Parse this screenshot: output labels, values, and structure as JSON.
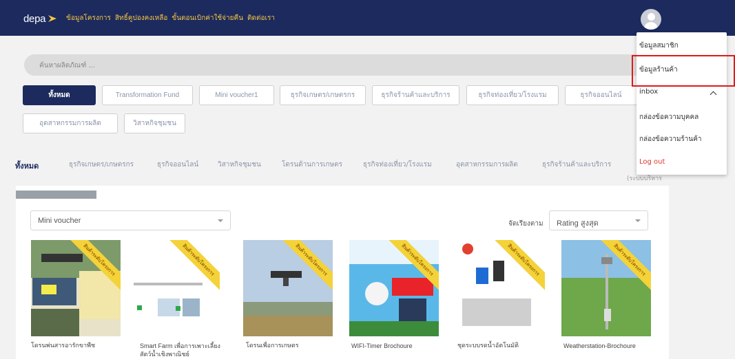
{
  "brand": {
    "logo_text": "depa"
  },
  "nav": {
    "links": [
      "ข้อมูลโครงการ",
      "สิทธิ์คูปองคงเหลือ",
      "ขั้นตอนเบิกค่าใช้จ่ายคืน",
      "ติดต่อเรา"
    ]
  },
  "search": {
    "placeholder": "ค้นหาผลิตภัณฑ์ ..."
  },
  "filter_chips": [
    {
      "label": "ทั้งหมด",
      "active": true
    },
    {
      "label": "Transformation Fund"
    },
    {
      "label": "Mini voucher1"
    },
    {
      "label": "ธุรกิจเกษตร/เกษตรกร"
    },
    {
      "label": "ธุรกิจร้านค้าและบริการ"
    },
    {
      "label": "ธุรกิจท่องเที่ยว/โรงแรม"
    },
    {
      "label": "ธุรกิจออนไลน์"
    },
    {
      "label": "อุตสาหกรรมการผลิต"
    },
    {
      "label": "วิสาหกิจชุมชน"
    }
  ],
  "category_tabs": [
    {
      "label": "ทั้งหมด",
      "active": true
    },
    {
      "label": "ธุรกิจเกษตร/เกษตรกร"
    },
    {
      "label": "ธุรกิจออนไลน์"
    },
    {
      "label": "วิสาหกิจชุมชน"
    },
    {
      "label": "โดรนด้านการเกษตร"
    },
    {
      "label": "ธุรกิจท่องเที่ยว/โรงแรม"
    },
    {
      "label": "อุตสาหกรรมการผลิต"
    },
    {
      "label": "ธุรกิจร้านค้าและบริการ"
    }
  ],
  "tab_tail": "(ระบบบริหาร",
  "voucher_select": {
    "value": "Mini voucher"
  },
  "sort": {
    "label": "จัดเรียงตาม",
    "value": "Rating สูงสุด"
  },
  "ribbon_text": "สินค้าระดับโครงการ",
  "products": [
    {
      "title": "โดรนพ่นสารอารักขาพืช"
    },
    {
      "title": "Smart Farm เพื่อการเพาะเลี้ยงสัตว์น้ำเชิงพาณิชย์"
    },
    {
      "title": "โดรนเพื่อการเกษตร"
    },
    {
      "title": "WIFI-Timer Brochoure"
    },
    {
      "title": "ชุดระบบรดน้ำอัตโนมัติ"
    },
    {
      "title": "Weatherstation-Brochoure"
    }
  ],
  "user_menu": {
    "items": [
      "ข้อมูลสมาชิก",
      "ข้อมูลร้านค้า",
      "inbox",
      "กล่องข้อความบุคคล",
      "กล่องข้อความร้านค้า",
      "Log out"
    ]
  },
  "colors": {
    "navbar": "#1c2a5e",
    "nav_link": "#f6c542",
    "logout": "#e0352b",
    "highlight": "#e01818"
  }
}
